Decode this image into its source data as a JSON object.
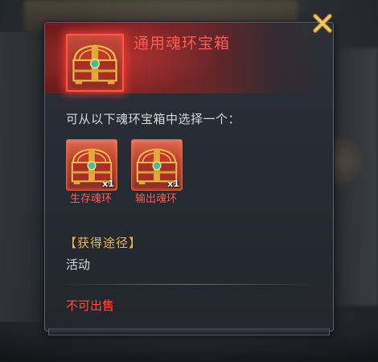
{
  "background": {
    "banner_text": "..."
  },
  "item": {
    "title": "通用魂环宝箱",
    "icon": "treasure-chest-icon",
    "rarity_color": "#ff5a52"
  },
  "description": "可从以下魂环宝箱中选择一个：",
  "choices": [
    {
      "label": "生存魂环",
      "count": "x1",
      "icon": "treasure-chest-icon"
    },
    {
      "label": "输出魂环",
      "count": "x1",
      "icon": "treasure-chest-icon"
    }
  ],
  "source": {
    "title": "【获得途径】",
    "value": "活动"
  },
  "sell_status": "不可出售",
  "colors": {
    "accent_red": "#ff5a52",
    "gold": "#e8b64a",
    "panel_bg": "#2b3039"
  }
}
